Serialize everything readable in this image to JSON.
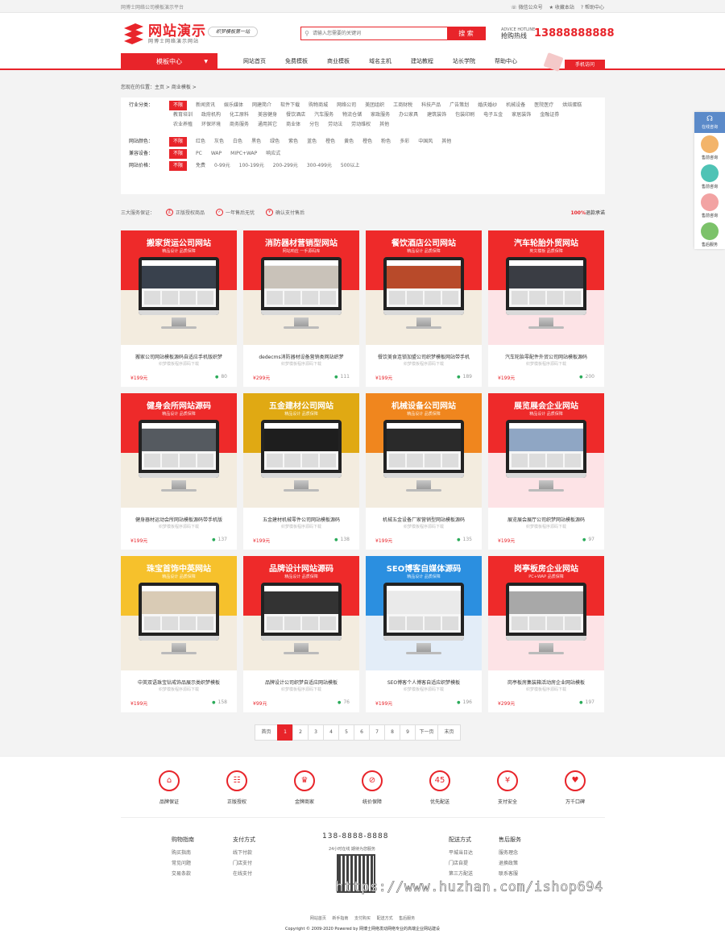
{
  "topbar": {
    "left": "网博士网络公司模板演示平台",
    "links": [
      "微信公众号",
      "收藏本站",
      "帮助中心"
    ]
  },
  "header": {
    "logo_title": "网站演示",
    "logo_sub": "网博士网络演示网站",
    "slogan": "织梦模板第一站",
    "search_placeholder": "请输入您需要的关键词",
    "search_button": "搜 索",
    "hotline_label_small": "ADVICE HOTLINE",
    "hotline_label": "抢购热线",
    "hotline": "13888888888"
  },
  "nav": {
    "category": "模板中心",
    "items": [
      "网站首页",
      "免费模板",
      "商业模板",
      "域名主机",
      "建站教程",
      "站长学院",
      "帮助中心"
    ],
    "mobile": "手机访问"
  },
  "breadcrumb": "您现在的位置：主页 > 商业模板 >",
  "filter": {
    "rows": [
      {
        "label": "行业分类：",
        "options": [
          "不限",
          "新闻资讯",
          "娱乐媒体",
          "网建简介",
          "软件下载",
          "购物商城",
          "网络公司",
          "美团组织",
          "工商财税",
          "科技产品",
          "广告策划",
          "婚庆婚纱",
          "机械设备",
          "医院医疗",
          "烘焙蛋糕",
          "教育培训",
          "政府机构",
          "化工原料",
          "美容健身",
          "餐饮酒店",
          "汽车服务",
          "物流仓储",
          "家政服务",
          "办公家具",
          "建筑装饰",
          "包装印刷",
          "电子五金",
          "家居装饰",
          "金融证券",
          "农业养殖",
          "环保环境",
          "商务服务",
          "通用其它",
          "商业体",
          "分包",
          "劳动法",
          "劳动维权",
          "其他"
        ]
      },
      {
        "label": "网站颜色：",
        "options": [
          "不限",
          "红色",
          "灰色",
          "白色",
          "黑色",
          "绿色",
          "紫色",
          "蓝色",
          "橙色",
          "黄色",
          "橙色",
          "粉色",
          "多彩",
          "中国风",
          "其他"
        ]
      },
      {
        "label": "兼容设备：",
        "options": [
          "不限",
          "PC",
          "WAP",
          "MIPC+WAP",
          "响应式"
        ]
      },
      {
        "label": "网站价格：",
        "options": [
          "不限",
          "免费",
          "0-99元",
          "100-199元",
          "200-299元",
          "300-499元",
          "500以上"
        ]
      }
    ]
  },
  "services": {
    "title": "三大服务保证：",
    "items": [
      "正版授权商品",
      "一年售后无忧",
      "确认支付售后"
    ],
    "right_accent": "100%",
    "right_text": "退款承诺"
  },
  "cards": [
    {
      "title": "搬家货运公司网站",
      "sub": "精品设计 品质保障",
      "name": "搬家公司网站模板源码自适应手机版织梦",
      "desc": "织梦模板程序源码下载",
      "price": "¥199元",
      "views": "80",
      "c1": "#ee2a2a",
      "c2": "#f3ecdf",
      "hero": "#39414d"
    },
    {
      "title": "消防器材营销型网站",
      "sub": "网站响应 一手源码库",
      "name": "dedecms消防器材设备营销类网站织梦",
      "desc": "织梦模板程序源码下载",
      "price": "¥299元",
      "views": "111",
      "c1": "#ee2a2a",
      "c2": "#f3ecdf",
      "hero": "#c9c2b9"
    },
    {
      "title": "餐饮酒店公司网站",
      "sub": "精品设计 品质保障",
      "name": "餐饮美食连锁加盟公司织梦模板网站带手机",
      "desc": "织梦模板程序源码下载",
      "price": "¥199元",
      "views": "189",
      "c1": "#ee2a2a",
      "c2": "#f3ecdf",
      "hero": "#b84a2a"
    },
    {
      "title": "汽车轮胎外贸网站",
      "sub": "英文模板 品质保障",
      "name": "汽车轮胎零配件外贸公司网站模板源码",
      "desc": "织梦模板程序源码下载",
      "price": "¥199元",
      "views": "200",
      "c1": "#ee2a2a",
      "c2": "#fde3e6",
      "hero": "#3a3d44"
    },
    {
      "title": "健身会所网站源码",
      "sub": "精品设计 品质保障",
      "name": "健身器材运动会所网站模板源码带手机版",
      "desc": "织梦模板程序源码下载",
      "price": "¥199元",
      "views": "137",
      "c1": "#ee2a2a",
      "c2": "#f3ecdf",
      "hero": "#555a60"
    },
    {
      "title": "五金建材公司网站",
      "sub": "精品设计 品质保障",
      "name": "五金建材机械零件公司网站模板源码",
      "desc": "织梦模板程序源码下载",
      "price": "¥199元",
      "views": "138",
      "c1": "#e0a913",
      "c2": "#f3ecdf",
      "hero": "#1e1e1e"
    },
    {
      "title": "机械设备公司网站",
      "sub": "精品设计 品质保障",
      "name": "机械五金设备厂家营销型网站模板源码",
      "desc": "织梦模板程序源码下载",
      "price": "¥199元",
      "views": "135",
      "c1": "#f0861e",
      "c2": "#f3ecdf",
      "hero": "#2a2a2a"
    },
    {
      "title": "展览展会企业网站",
      "sub": "精品设计 品质保障",
      "name": "展览展会展厅公司织梦网站模板源码",
      "desc": "织梦模板程序源码下载",
      "price": "¥199元",
      "views": "97",
      "c1": "#ee2a2a",
      "c2": "#fde3e6",
      "hero": "#8fa6c4"
    },
    {
      "title": "珠宝首饰中英网站",
      "sub": "精品设计 品质保障",
      "name": "中英双语珠宝钻戒饰品展示类织梦模板",
      "desc": "织梦模板程序源码下载",
      "price": "¥199元",
      "views": "158",
      "c1": "#f6c12c",
      "c2": "#f3ecdf",
      "hero": "#d9cbb5"
    },
    {
      "title": "品牌设计网站源码",
      "sub": "精品设计 品质保障",
      "name": "品牌设计公司织梦自适应网站模板",
      "desc": "织梦模板程序源码下载",
      "price": "¥99元",
      "views": "76",
      "c1": "#ee2a2a",
      "c2": "#f3ecdf",
      "hero": "#333333"
    },
    {
      "title": "SEO博客自媒体源码",
      "sub": "精品设计 品质保障",
      "name": "SEO博客个人博客自适应织梦模板",
      "desc": "织梦模板程序源码下载",
      "price": "¥199元",
      "views": "196",
      "c1": "#2b8fe0",
      "c2": "#e3edf8",
      "hero": "#eaeaea"
    },
    {
      "title": "岗亭板房企业网站",
      "sub": "PC+WAP 品质保障",
      "name": "岗亭板房集装箱活动房企业网站模板",
      "desc": "织梦模板程序源码下载",
      "price": "¥299元",
      "views": "197",
      "c1": "#ee2a2a",
      "c2": "#fde3e6",
      "hero": "#a8a8a8"
    }
  ],
  "pager": {
    "first": "首页",
    "pages": [
      "1",
      "2",
      "3",
      "4",
      "5",
      "6",
      "7",
      "8",
      "9"
    ],
    "current": "1",
    "next": "下一页",
    "last": "末页"
  },
  "guarantees": [
    {
      "label": "品牌保证",
      "icon": "shop-icon",
      "glyph": "⌂"
    },
    {
      "label": "正版授权",
      "icon": "certificate-icon",
      "glyph": "☷"
    },
    {
      "label": "金牌商家",
      "icon": "trophy-icon",
      "glyph": "♛"
    },
    {
      "label": "统价保障",
      "icon": "compass-icon",
      "glyph": "⊘"
    },
    {
      "label": "优先配送",
      "icon": "clock-45-icon",
      "glyph": "45"
    },
    {
      "label": "支付安全",
      "icon": "yen-icon",
      "glyph": "¥"
    },
    {
      "label": "万千口碑",
      "icon": "thumbs-up-icon",
      "glyph": "♥"
    }
  ],
  "footer": {
    "cols": [
      {
        "title": "购物指南",
        "items": [
          "购买指南",
          "常见问题",
          "交易条款"
        ]
      },
      {
        "title": "支付方式",
        "items": [
          "线下付款",
          "门店支付",
          "在线支付"
        ]
      },
      {
        "title": "配送方式",
        "items": [
          "平城当日达",
          "门店自提",
          "第三方配送"
        ]
      },
      {
        "title": "售后服务",
        "items": [
          "服务理念",
          "退换政策",
          "联系客服"
        ]
      }
    ],
    "phone": "138-8888-8888",
    "phone_sub": "24小时在线 期待为您服务",
    "watermark": "https://www.huzhan.com/ishop694",
    "links": "网站首页 新手指南 支付购买 配送方式 售后服务",
    "copyright": "Copyright © 2009-2020 Powered by 网博士网络发动网络专业的高端企业网站建设"
  },
  "float": {
    "cs": "在线咨询",
    "items": [
      "售前咨询",
      "售前咨询",
      "售前咨询",
      "售后服务"
    ],
    "colors": [
      "#f3b46a",
      "#4fc3b5",
      "#f2a3a3",
      "#7cc26a"
    ]
  }
}
